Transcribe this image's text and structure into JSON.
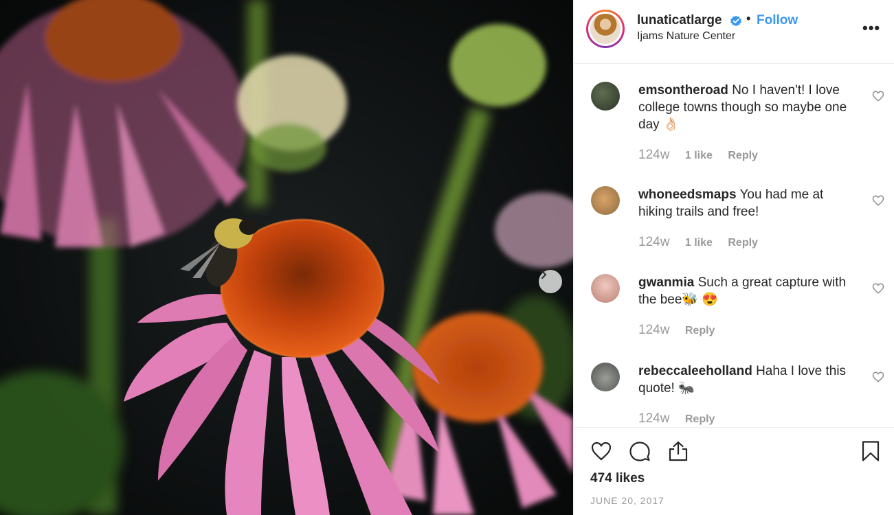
{
  "post": {
    "username": "lunaticatlarge",
    "follow_label": "Follow",
    "separator": "•",
    "location": "Ijams Nature Center",
    "more_label": "•••",
    "likes": "474 likes",
    "date": "JUNE 20, 2017"
  },
  "comments": [
    {
      "user": "emsontheroad",
      "text": "No I haven't! I love college towns though so maybe one day 👌🏻",
      "time": "124w",
      "likes": "1 like",
      "reply": "Reply"
    },
    {
      "user": "whoneedsmaps",
      "text": "You had me at hiking trails and free!",
      "time": "124w",
      "likes": "1 like",
      "reply": "Reply"
    },
    {
      "user": "gwanmia",
      "text": "Such a great capture with the bee🐝 😍",
      "time": "124w",
      "likes": "",
      "reply": "Reply"
    },
    {
      "user": "rebeccaleeholland",
      "text": "Haha I love this quote! 🐜",
      "time": "124w",
      "likes": "",
      "reply": "Reply"
    }
  ],
  "icons": {
    "like": "heart-icon",
    "comment": "comment-icon",
    "share": "share-icon",
    "save": "bookmark-icon",
    "next": "chevron-right-icon",
    "verified": "verified-badge-icon"
  },
  "colors": {
    "accent": "#3897f0",
    "text": "#262626",
    "muted": "#999999",
    "border": "#efefef"
  }
}
